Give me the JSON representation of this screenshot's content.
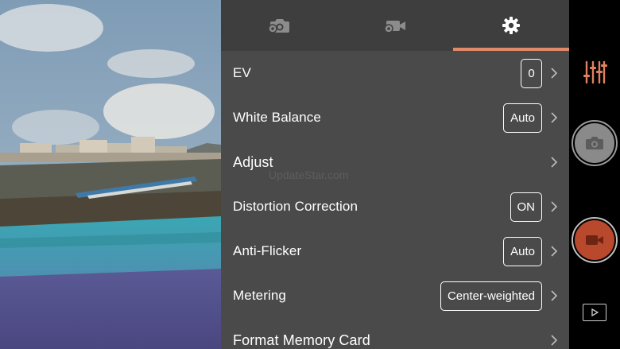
{
  "tabs": [
    {
      "name": "photo-settings",
      "icon": "camera-gear-icon",
      "active": false
    },
    {
      "name": "video-settings",
      "icon": "video-gear-icon",
      "active": false
    },
    {
      "name": "general-settings",
      "icon": "gear-icon",
      "active": true
    }
  ],
  "settings": [
    {
      "label": "EV",
      "value": "0"
    },
    {
      "label": "White Balance",
      "value": "Auto"
    },
    {
      "label": "Adjust",
      "value": null
    },
    {
      "label": "Distortion Correction",
      "value": "ON"
    },
    {
      "label": "Anti-Flicker",
      "value": "Auto"
    },
    {
      "label": "Metering",
      "value": "Center-weighted"
    },
    {
      "label": "Format Memory Card",
      "value": null
    }
  ],
  "watermark": "UpdateStar.com",
  "controls": {
    "adjust_icon": "sliders-icon",
    "shutter_icon": "camera-icon",
    "record_icon": "video-camera-icon",
    "playback_icon": "play-icon"
  },
  "colors": {
    "accent": "#e08a6a",
    "record": "#b8492d",
    "panel": "#4a4a4a",
    "tabbar": "#3e3e3e"
  }
}
